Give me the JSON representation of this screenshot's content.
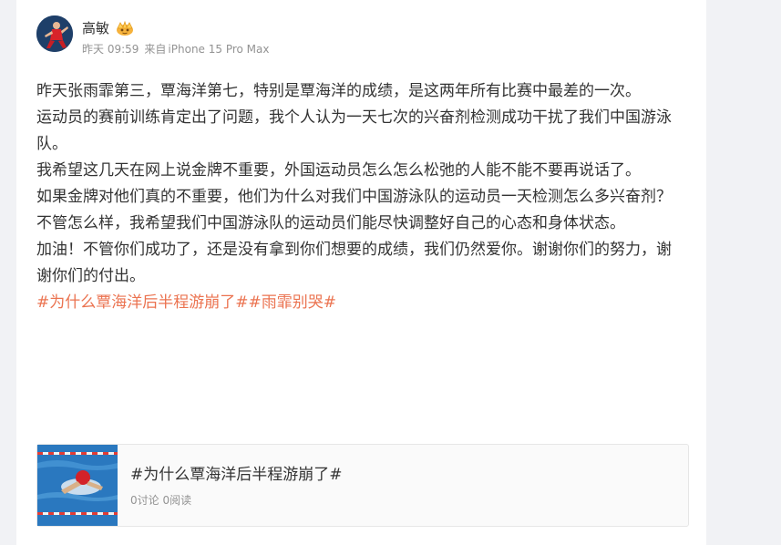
{
  "post": {
    "author": "高敏",
    "badge_icon": "gold-crown-badge-icon",
    "time": "昨天 09:59",
    "source_prefix": "来自",
    "source": "iPhone 15 Pro Max",
    "paragraphs": [
      "昨天张雨霏第三，覃海洋第七，特别是覃海洋的成绩，是这两年所有比赛中最差的一次。",
      "运动员的赛前训练肯定出了问题，我个人认为一天七次的兴奋剂检测成功干扰了我们中国游泳队。",
      "我希望这几天在网上说金牌不重要，外国运动员怎么怎么松弛的人能不能不要再说话了。",
      "如果金牌对他们真的不重要，他们为什么对我们中国游泳队的运动员一天检测怎么多兴奋剂？",
      "不管怎么样，我希望我们中国游泳队的运动员们能尽快调整好自己的心态和身体状态。",
      "加油！不管你们成功了，还是没有拿到你们想要的成绩，我们仍然爱你。谢谢你们的努力，谢谢你们的付出。"
    ],
    "hashtags": "#为什么覃海洋后半程游崩了##雨霏别哭#"
  },
  "topic_card": {
    "title": "#为什么覃海洋后半程游崩了#",
    "stats": "0讨论 0阅读"
  },
  "colors": {
    "hashtag": "#eb7350",
    "text": "#333333",
    "muted": "#939393"
  }
}
